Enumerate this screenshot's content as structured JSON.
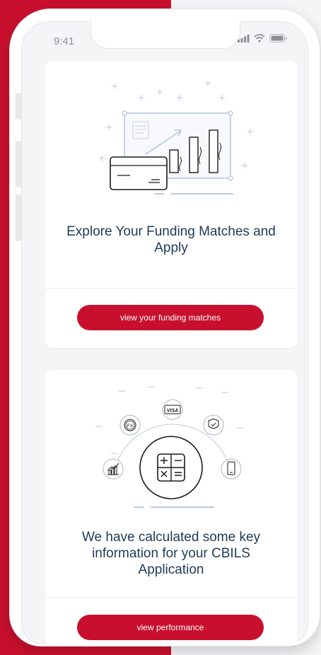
{
  "status_bar": {
    "time": "9:41"
  },
  "cards": [
    {
      "title": "Explore Your Funding Matches and Apply",
      "button_label": "view your funding matches",
      "illustration": "funding-chart-illustration"
    },
    {
      "title": "We have calculated some key information for your CBILS Application",
      "button_label": "view performance",
      "illustration": "calculator-illustration",
      "illustration_labels": {
        "fx": "FX",
        "visa": "VISA"
      }
    }
  ],
  "colors": {
    "brand_red": "#c8102e",
    "title_navy": "#1f3a56",
    "illustration_blue": "#a9b9d6"
  }
}
